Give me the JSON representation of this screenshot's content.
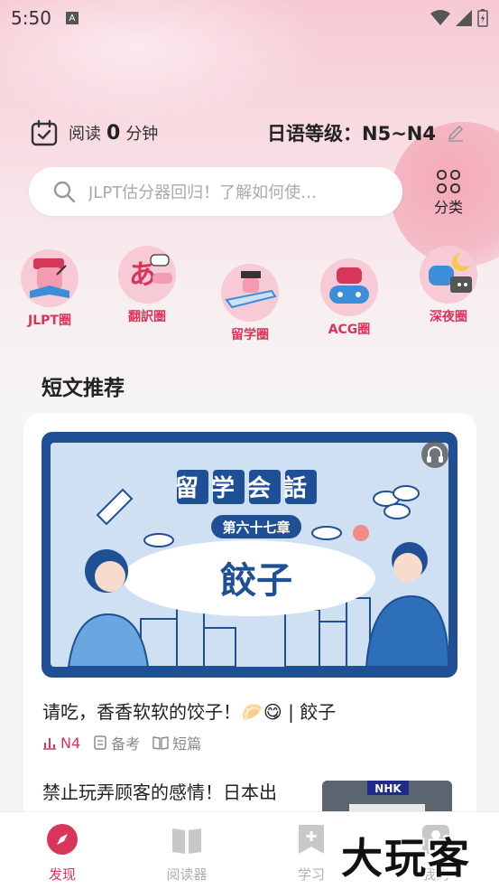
{
  "status_bar": {
    "time": "5:50"
  },
  "header": {
    "reading_prefix": "阅读",
    "reading_minutes": "0",
    "reading_unit": "分钟",
    "level_text": "日语等级：N5~N4"
  },
  "search": {
    "placeholder": "JLPT估分器回归！了解如何使…",
    "category_label": "分类"
  },
  "circles": [
    {
      "label": "JLPT圈"
    },
    {
      "label": "翻訳圏"
    },
    {
      "label": "留学圈"
    },
    {
      "label": "ACG圈"
    },
    {
      "label": "深夜圈"
    }
  ],
  "section": {
    "title": "短文推荐"
  },
  "articles": [
    {
      "title": "请吃，香香软软的饺子！🥟😋 | 餃子",
      "level": "N4",
      "tag1": "备考",
      "tag2": "短篇",
      "cover_banner": "留学会話",
      "cover_chapter": "第六十七章",
      "cover_title": "餃子"
    },
    {
      "title": "禁止玩弄顾客的感情！日本出",
      "thumb_logo": "NHK"
    }
  ],
  "bottom_nav": [
    {
      "label": "发现",
      "active": true
    },
    {
      "label": "阅读器",
      "active": false
    },
    {
      "label": "学习",
      "active": false
    },
    {
      "label": "我的",
      "active": false
    }
  ],
  "watermark": "大玩客",
  "colors": {
    "accent": "#d8355b",
    "cover_blue": "#1f4f95"
  }
}
